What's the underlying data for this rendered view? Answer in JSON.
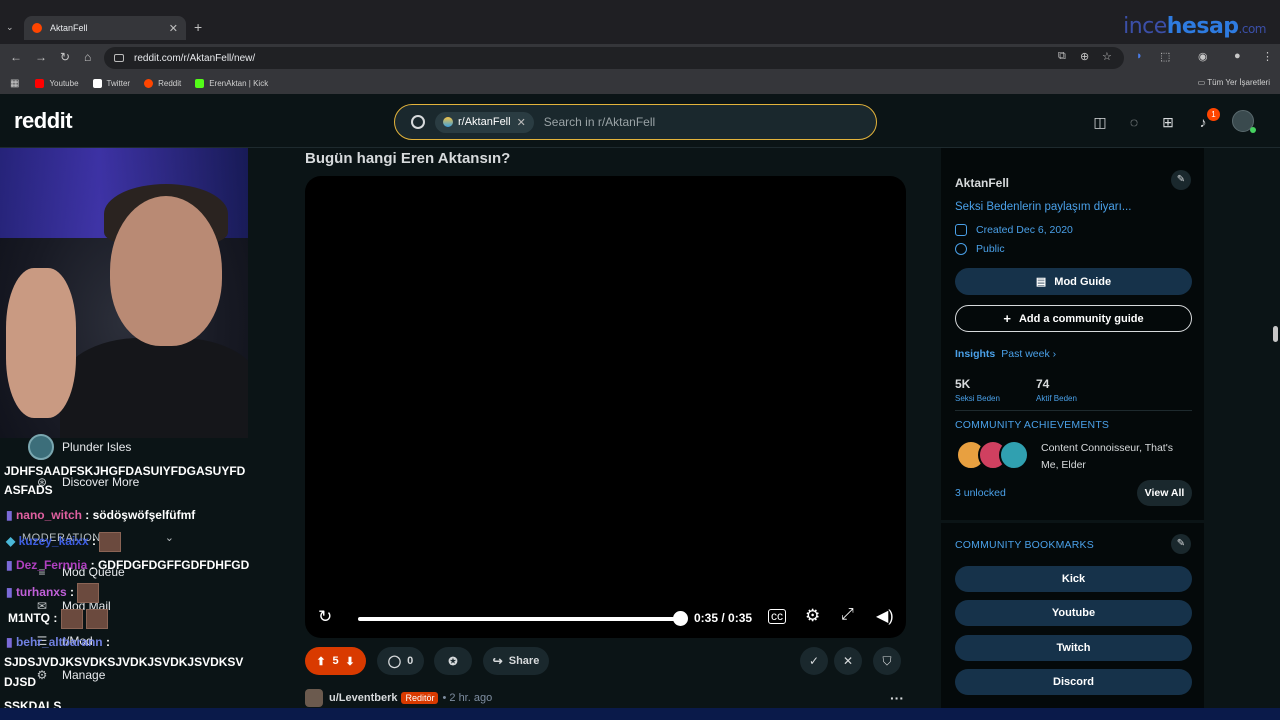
{
  "browser": {
    "tab_title": "AktanFell",
    "tab_close": "✕",
    "new_tab": "+",
    "watermark_a": "ince",
    "watermark_b": "hesap",
    "watermark_c": ".com",
    "url": "reddit.com/r/AktanFell/new/",
    "bookmarks": [
      {
        "label": "Youtube",
        "color": "#ff0000"
      },
      {
        "label": "Twitter",
        "color": "#ffffff"
      },
      {
        "label": "Reddit",
        "color": "#ff4500"
      },
      {
        "label": "ErenAktan | Kick",
        "color": "#53fc18"
      }
    ],
    "all_bookmarks": "Tüm Yer İşaretleri"
  },
  "header": {
    "logo": "reddit",
    "chip": "r/AktanFell",
    "search_placeholder": "Search in r/AktanFell",
    "notif_count": "1"
  },
  "overlay": {
    "sidebar_items": [
      {
        "label": "Plunder Isles",
        "icon": "game-icon"
      },
      {
        "label": "Discover More",
        "icon": "gamepad-icon"
      },
      {
        "label": "MODERATION",
        "icon": ""
      },
      {
        "label": "Mod Queue",
        "icon": "queue-icon"
      },
      {
        "label": "Mod Mail",
        "icon": "mail-icon"
      },
      {
        "label": "r/Mod",
        "icon": "mod-icon"
      },
      {
        "label": "Manage",
        "icon": "gear-icon"
      }
    ],
    "chat": [
      {
        "user": "",
        "msg": "JDHFSAADFSKJHGFDASUIYFDGASUYFD"
      },
      {
        "user": "",
        "msg": "ASFADS"
      },
      {
        "user": "nano_witch",
        "msg": " : södöşwöfşelfüfmf"
      },
      {
        "user": "kuzey_kaixx",
        "msg": " :"
      },
      {
        "user": "Dez_Fernnia",
        "msg": " : GDFDGFDGFFGDFDHFGD"
      },
      {
        "user": "turhanxs",
        "msg": " :"
      },
      {
        "user": "",
        "msg": "M1NTQ :"
      },
      {
        "user": "behr_altbarann",
        "msg": " :"
      },
      {
        "user": "",
        "msg": "SJDSJVDJKSVDKSJVDKJSVDKJSVDKSV"
      },
      {
        "user": "",
        "msg": "DJSD"
      },
      {
        "user": "",
        "msg": "ŞSKDALS"
      }
    ]
  },
  "post": {
    "title": "Bugün hangi Eren Aktansın?",
    "time": "0:35 / 0:35",
    "progress": 1.0,
    "votes": "5",
    "comments": "0",
    "share": "Share",
    "comment_user": "u/Leventberk",
    "flair": "Reditör",
    "ago": "• 2 hr. ago"
  },
  "sidebar": {
    "name": "AktanFell",
    "desc": "Seksi Bedenlerin paylaşım diyarı...",
    "created": "Created Dec 6, 2020",
    "visibility": "Public",
    "mod_guide": "Mod Guide",
    "add_guide": "Add a community guide",
    "insights": "Insights",
    "period": "Past week ›",
    "stats": [
      {
        "num": "5K",
        "label": "Seksi Beden"
      },
      {
        "num": "74",
        "label": "Aktif Beden"
      }
    ],
    "ach_title": "COMMUNITY ACHIEVEMENTS",
    "ach_text": "Content Connoisseur, That's Me, Elder",
    "unlocked": "3 unlocked",
    "view_all": "View All",
    "bookmarks_title": "COMMUNITY BOOKMARKS",
    "bookmarks": [
      "Kick",
      "Youtube",
      "Twitch",
      "Discord"
    ]
  }
}
